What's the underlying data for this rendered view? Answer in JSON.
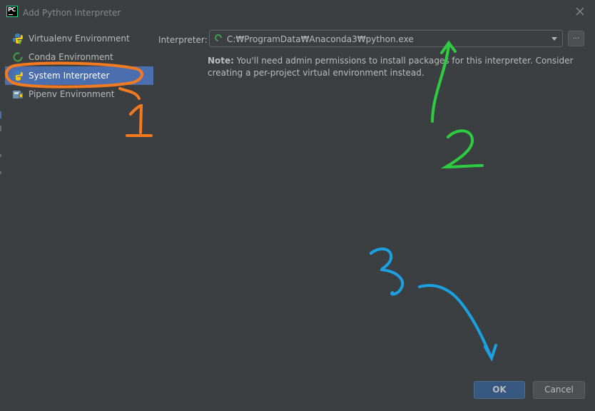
{
  "window": {
    "title": "Add Python Interpreter",
    "app_icon_text": "PC"
  },
  "sidebar": {
    "items": [
      {
        "label": "Virtualenv Environment",
        "icon": "python-virtualenv-icon",
        "selected": false
      },
      {
        "label": "Conda Environment",
        "icon": "conda-icon",
        "selected": false
      },
      {
        "label": "System Interpreter",
        "icon": "python-icon",
        "selected": true
      },
      {
        "label": "Pipenv Environment",
        "icon": "pipenv-icon",
        "selected": false
      }
    ]
  },
  "main": {
    "interpreter_label": "Interpreter:",
    "interpreter_value": "C:₩ProgramData₩Anaconda3₩python.exe",
    "browse_label": "...",
    "note_bold": "Note:",
    "note_text": " You'll need admin permissions to install packages for this interpreter. Consider creating a per-project virtual environment instead."
  },
  "footer": {
    "ok_label": "OK",
    "cancel_label": "Cancel"
  },
  "annotations": {
    "label_1": "1",
    "label_2": "2",
    "label_3": "3",
    "color_1": "#f47a20",
    "color_2": "#2ecc40",
    "color_3": "#1ba1e2"
  },
  "colors": {
    "background": "#3c3f41",
    "selection": "#4b6eaf",
    "ok_button": "#365880"
  }
}
